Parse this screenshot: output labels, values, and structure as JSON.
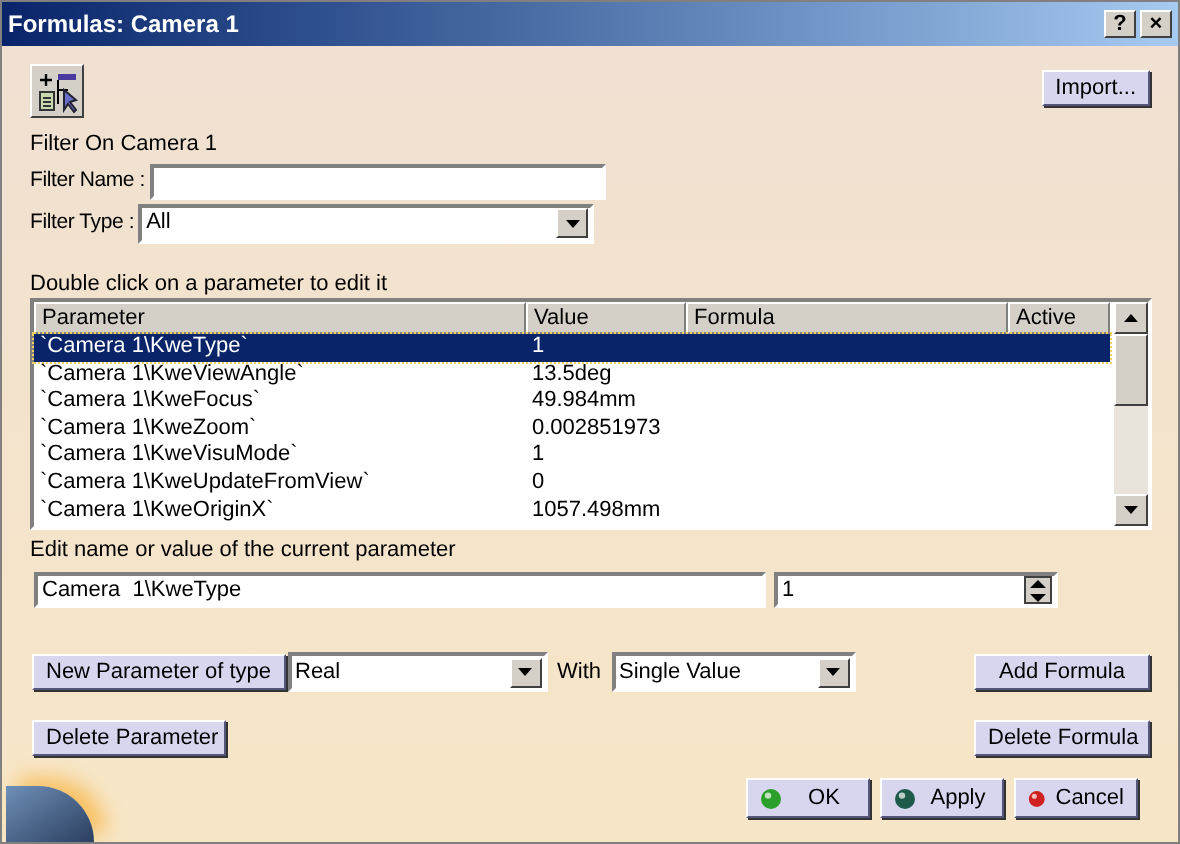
{
  "window": {
    "title": "Formulas: Camera  1"
  },
  "title_buttons": [
    "?",
    "×"
  ],
  "import_button": "Import...",
  "filter_on": "Filter On Camera  1",
  "filter_name": {
    "label": "Filter Name :"
  },
  "filter_type": {
    "label": "Filter Type :",
    "value": "All"
  },
  "table_hint": "Double click on a parameter to edit it",
  "table": {
    "columns": [
      "Parameter",
      "Value",
      "Formula",
      "Active"
    ],
    "rows": [
      {
        "parameter": "`Camera  1\\KweType`",
        "value": "1",
        "selected": true
      },
      {
        "parameter": "`Camera  1\\KweViewAngle`",
        "value": "13.5deg",
        "selected": false
      },
      {
        "parameter": "`Camera  1\\KweFocus`",
        "value": "49.984mm",
        "selected": false
      },
      {
        "parameter": "`Camera  1\\KweZoom`",
        "value": "0.002851973",
        "selected": false
      },
      {
        "parameter": "`Camera  1\\KweVisuMode`",
        "value": "1",
        "selected": false
      },
      {
        "parameter": "`Camera  1\\KweUpdateFromView`",
        "value": "0",
        "selected": false
      },
      {
        "parameter": "`Camera  1\\KweOriginX`",
        "value": "1057.498mm",
        "selected": false
      }
    ]
  },
  "edit_label": "Edit name or value of the current parameter",
  "name_field": {
    "value": "Camera  1\\KweType"
  },
  "value_field": {
    "value": "1"
  },
  "new_parameter_button": "New Parameter of type",
  "type_select": {
    "value": "Real"
  },
  "with_label": "With",
  "with_select": {
    "value": "Single Value"
  },
  "add_formula_button": "Add Formula",
  "delete_parameter_button": "Delete Parameter",
  "delete_formula_button": "Delete Formula",
  "dialog_buttons": [
    {
      "label": "OK",
      "kind": "ok"
    },
    {
      "label": "Apply",
      "kind": "apply"
    },
    {
      "label": "Cancel",
      "kind": "cancel"
    }
  ]
}
